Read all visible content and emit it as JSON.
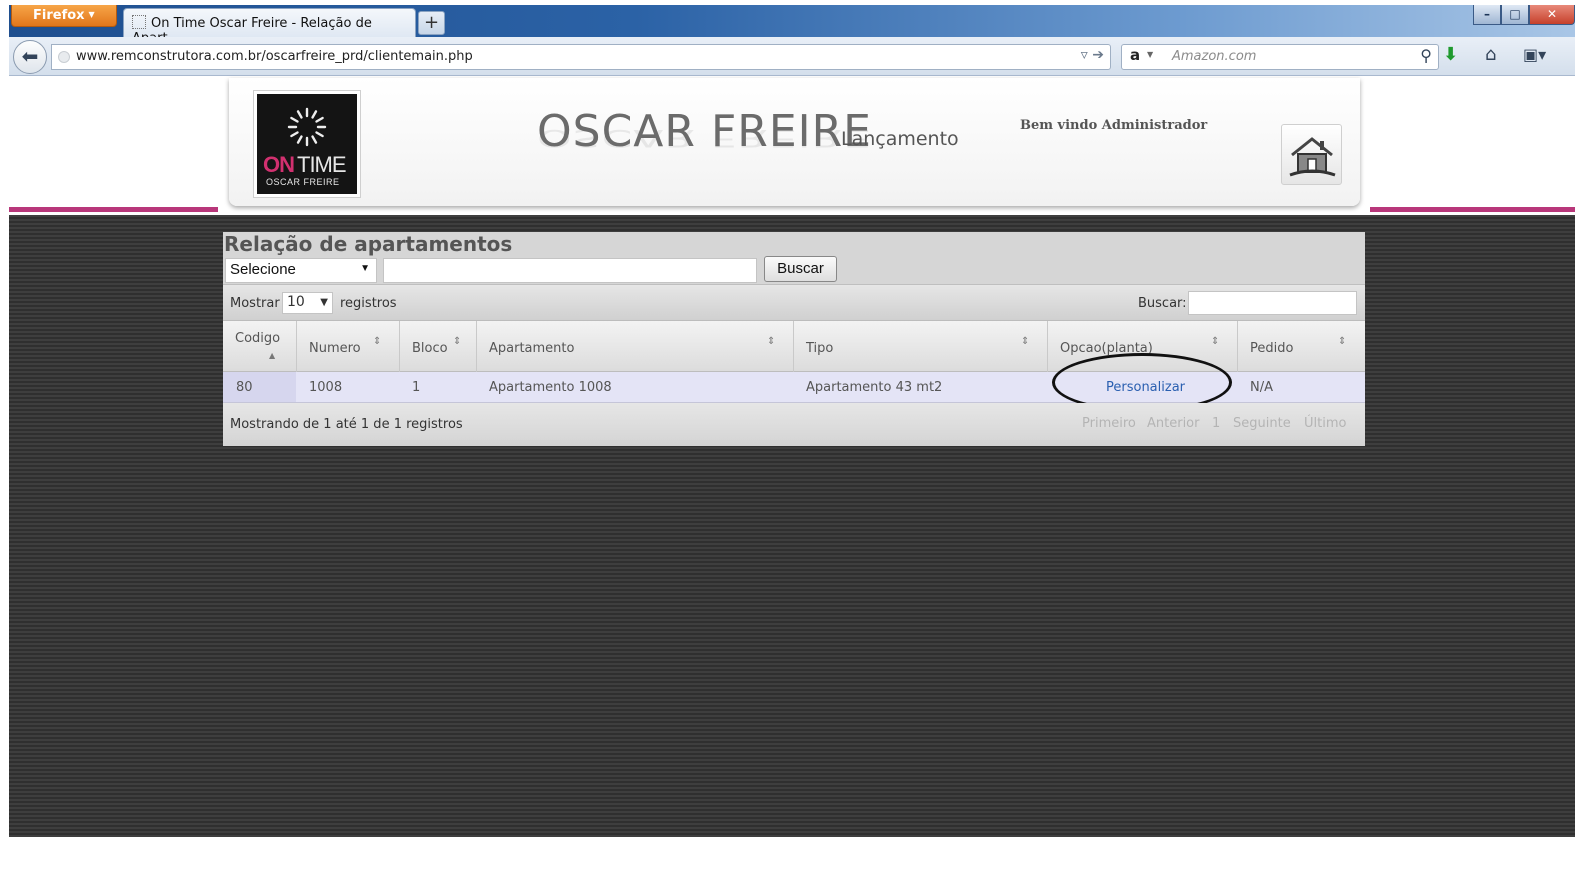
{
  "browser": {
    "menu_label": "Firefox",
    "tab_title": "On Time Oscar Freire - Relação de Apart...",
    "new_tab": "+",
    "url": "www.remconstrutora.com.br/oscarfreire_prd/clientemain.php",
    "search_engine_placeholder": "Amazon.com",
    "icons": [
      "back-icon",
      "globe-icon",
      "bookmark-star-icon",
      "go-arrow-icon",
      "amazon-logo-icon",
      "search-icon",
      "download-icon",
      "home-icon",
      "bookmarks-icon"
    ]
  },
  "header": {
    "logo": {
      "on": "ON",
      "time": "TIME",
      "sub": "OSCAR FREIRE"
    },
    "title": "OSCAR FREIRE",
    "subtitle": "Lançamento",
    "welcome": "Bem vindo Administrador",
    "accent_color": "#b8377a"
  },
  "grid": {
    "title": "Relação de apartamentos",
    "filter_select": "Selecione",
    "filter_button": "Buscar",
    "show_label": "Mostrar",
    "page_length": "10",
    "records_label": "registros",
    "search_label": "Buscar:",
    "columns": [
      "Codigo",
      "Numero",
      "Bloco",
      "Apartamento",
      "Tipo",
      "Opcao(planta)",
      "Pedido"
    ],
    "rows": [
      {
        "codigo": "80",
        "numero": "1008",
        "bloco": "1",
        "apartamento": "Apartamento 1008",
        "tipo": "Apartamento 43 mt2",
        "opcao": "Personalizar",
        "pedido": "N/A"
      }
    ],
    "info": "Mostrando de 1 até 1 de 1 registros",
    "pagination": {
      "first": "Primeiro",
      "previous": "Anterior",
      "page": "1",
      "next": "Seguinte",
      "last": "Último"
    }
  }
}
